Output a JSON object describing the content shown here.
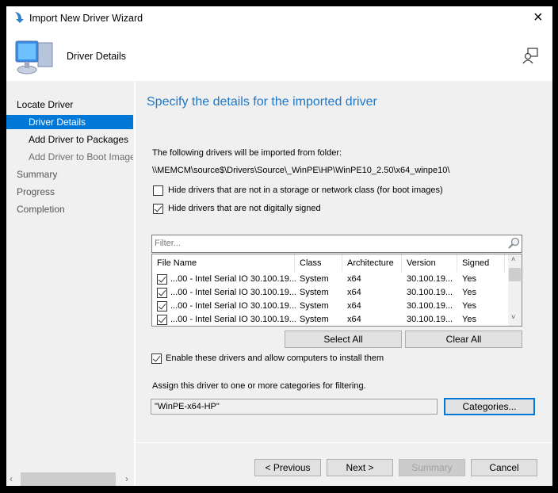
{
  "window": {
    "title": "Import New Driver Wizard",
    "close": "×"
  },
  "header": {
    "title": "Driver Details"
  },
  "sidebar": {
    "items": [
      {
        "label": "Locate Driver"
      },
      {
        "label": "Driver Details"
      },
      {
        "label": "Add Driver to Packages"
      },
      {
        "label": "Add Driver to Boot Image"
      },
      {
        "label": "Summary"
      },
      {
        "label": "Progress"
      },
      {
        "label": "Completion"
      }
    ]
  },
  "main": {
    "heading": "Specify the details for the imported driver",
    "intro": "The following drivers will be imported from folder:",
    "folder": "\\\\MEMCM\\source$\\Drivers\\Source\\_WinPE\\HP\\WinPE10_2.50\\x64_winpe10\\",
    "hide_storage": {
      "label": "Hide drivers that are not in a storage or network class (for boot images)",
      "checked": false
    },
    "hide_unsigned": {
      "label": "Hide drivers that are not digitally signed",
      "checked": true
    },
    "filter_placeholder": "Filter...",
    "table": {
      "columns": [
        "File Name",
        "Class",
        "Architecture",
        "Version",
        "Signed"
      ],
      "rows": [
        {
          "checked": true,
          "file": "...00 - Intel Serial IO 30.100.19...",
          "class": "System",
          "arch": "x64",
          "version": "30.100.19...",
          "signed": "Yes"
        },
        {
          "checked": true,
          "file": "...00 - Intel Serial IO 30.100.19...",
          "class": "System",
          "arch": "x64",
          "version": "30.100.19...",
          "signed": "Yes"
        },
        {
          "checked": true,
          "file": "...00 - Intel Serial IO 30.100.19...",
          "class": "System",
          "arch": "x64",
          "version": "30.100.19...",
          "signed": "Yes"
        },
        {
          "checked": true,
          "file": "...00 - Intel Serial IO 30.100.19...",
          "class": "System",
          "arch": "x64",
          "version": "30.100.19...",
          "signed": "Yes"
        }
      ]
    },
    "select_all": "Select All",
    "clear_all": "Clear All",
    "enable": {
      "label": "Enable these drivers and allow computers to install them",
      "checked": true
    },
    "assign_label": "Assign this driver to one or more categories for filtering.",
    "categories_value": "\"WinPE-x64-HP\"",
    "categories_button": "Categories..."
  },
  "footer": {
    "previous": "< Previous",
    "next": "Next >",
    "summary": "Summary",
    "cancel": "Cancel"
  },
  "colors": {
    "accent": "#0078d7",
    "heading": "#1e78c8"
  }
}
